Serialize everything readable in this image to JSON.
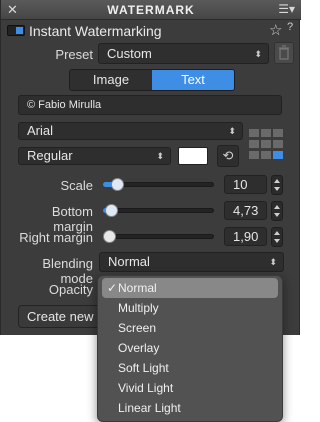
{
  "window": {
    "title": "WATERMARK",
    "close_glyph": "✕",
    "menu_glyph": "☰▾"
  },
  "header": {
    "label": "Instant Watermarking",
    "enabled": true
  },
  "preset": {
    "label": "Preset",
    "value": "Custom"
  },
  "mode_tabs": {
    "items": [
      "Image",
      "Text"
    ],
    "active": "Text"
  },
  "text_value": "© Fabio Mirulla",
  "font": {
    "family": "Arial",
    "style": "Regular",
    "color": "#ffffff"
  },
  "position_grid": {
    "selected": "bottom-right"
  },
  "scale": {
    "label": "Scale",
    "value": "10",
    "level": 0.07
  },
  "bottom_margin": {
    "label": "Bottom margin",
    "value": "4,73",
    "level": 0.02
  },
  "right_margin": {
    "label": "Right margin",
    "value": "1,90",
    "level": 0.0
  },
  "blending": {
    "label": "Blending mode",
    "value": "Normal",
    "options": [
      "Normal",
      "Multiply",
      "Screen",
      "Overlay",
      "Soft Light",
      "Vivid Light",
      "Linear Light"
    ],
    "selected_index": 0
  },
  "opacity": {
    "label": "Opacity"
  },
  "create_button": {
    "label": "Create new p"
  },
  "colors": {
    "accent": "#3e8ee6",
    "panel": "#3c3c3c"
  }
}
